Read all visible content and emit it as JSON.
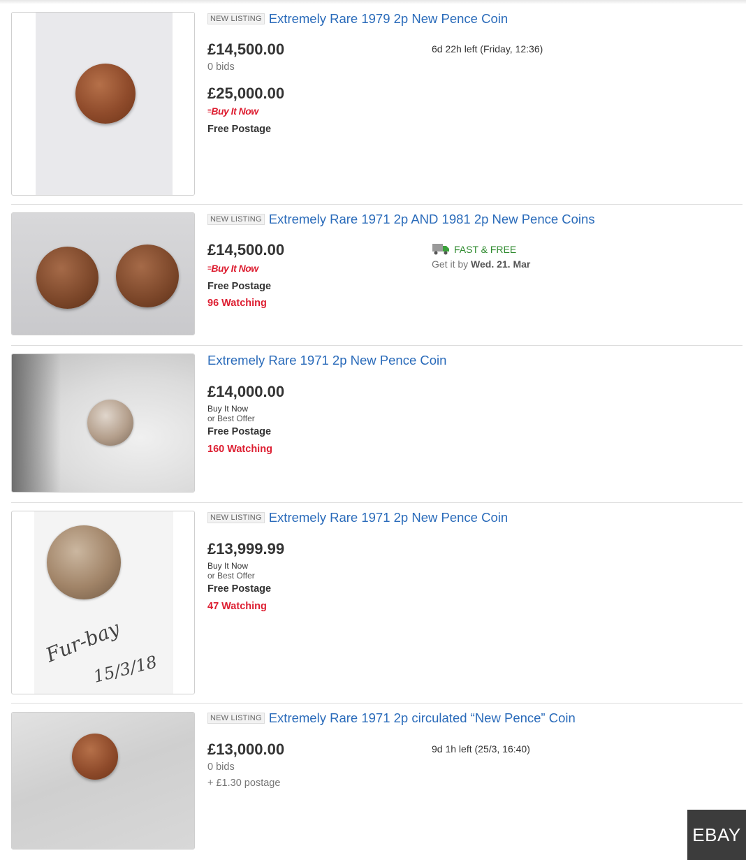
{
  "badge_label": "NEW LISTING",
  "buy_it_now_logo": "Buy It Now",
  "listings": [
    {
      "title": "Extremely Rare 1979 2p New Pence Coin",
      "price_auction": "£14,500.00",
      "bids": "0 bids",
      "time_left": "6d 22h left (Friday, 12:36)",
      "price_bin": "£25,000.00",
      "postage": "Free Postage"
    },
    {
      "title": "Extremely Rare 1971 2p AND 1981 2p New Pence Coins",
      "price": "£14,500.00",
      "postage": "Free Postage",
      "watching": "96 Watching",
      "shipping_badge": "FAST & FREE",
      "delivery_prefix": "Get it by",
      "delivery_date": "Wed. 21. Mar"
    },
    {
      "title": "Extremely Rare 1971 2p New Pence Coin",
      "price": "£14,000.00",
      "buy_it_now": "Buy It Now",
      "best_offer": "or Best Offer",
      "postage": "Free Postage",
      "watching": "160 Watching"
    },
    {
      "title": "Extremely Rare 1971 2p New Pence Coin",
      "price": "£13,999.99",
      "buy_it_now": "Buy It Now",
      "best_offer": "or Best Offer",
      "postage": "Free Postage",
      "watching": "47 Watching",
      "handwriting_line1": "Fur-bay",
      "handwriting_line2": "15/3/18"
    },
    {
      "title": "Extremely Rare 1971 2p circulated “New Pence” Coin",
      "price": "£13,000.00",
      "bids": "0 bids",
      "time_left": "9d 1h left (25/3, 16:40)",
      "postage": "+ £1.30 postage"
    }
  ],
  "corner_tag": "EBAY",
  "colors": {
    "link": "#2a6bba",
    "watching_red": "#dd1e31",
    "fast_free_green": "#2e8a2e",
    "price_text": "#333333"
  }
}
